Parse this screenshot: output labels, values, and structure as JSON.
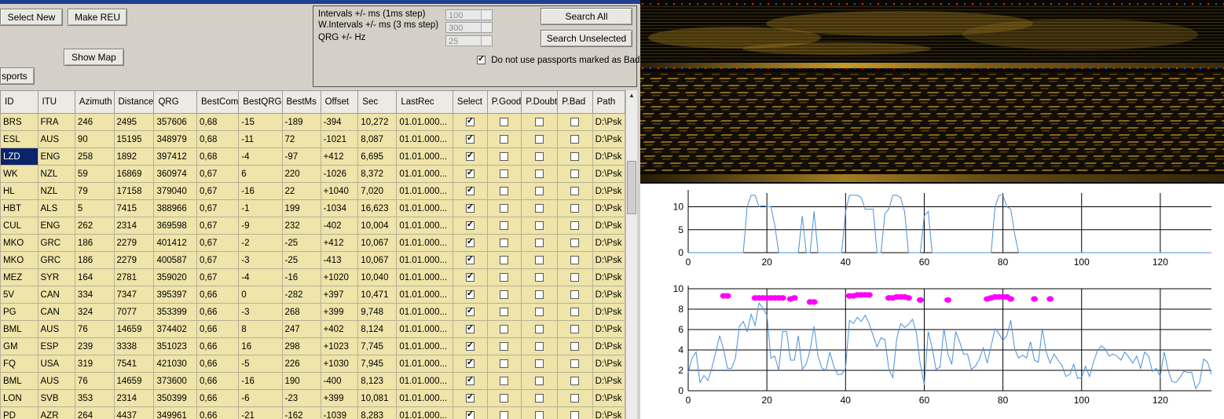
{
  "toolbar": {
    "select_new": "Select New",
    "make_reu": "Make REU",
    "show_map": "Show Map",
    "passports": "sports"
  },
  "search": {
    "intervals_label": "Intervals +/- ms (1ms step)",
    "intervals_value": "100",
    "w_intervals_label": "W.Intervals +/- ms (3 ms step)",
    "w_intervals_value": "300",
    "qrg_label": "QRG +/- Hz",
    "qrg_value": "25",
    "search_all": "Search All",
    "search_unselected": "Search Unselected",
    "do_not_use_bad_label": "Do not use passports marked as Bad",
    "do_not_use_bad_checked": true
  },
  "table": {
    "columns": [
      "ID",
      "ITU",
      "Azimuth",
      "Distance",
      "QRG",
      "BestCom",
      "BestQRG",
      "BestMs",
      "Offset",
      "Sec",
      "LastRec",
      "Select",
      "P.Good",
      "P.Doubt",
      "P.Bad",
      "Path"
    ],
    "selected_row": 2,
    "rows": [
      [
        "BRS",
        "FRA",
        "246",
        "2495",
        "357606",
        "0,68",
        "-15",
        "-189",
        "-394",
        "10,272",
        "01.01.000...",
        true,
        false,
        false,
        false,
        "D:\\Psk"
      ],
      [
        "ESL",
        "AUS",
        "90",
        "15195",
        "348979",
        "0,68",
        "-11",
        "72",
        "-1021",
        "8,087",
        "01.01.000...",
        true,
        false,
        false,
        false,
        "D:\\Psk"
      ],
      [
        "LZD",
        "ENG",
        "258",
        "1892",
        "397412",
        "0,68",
        "-4",
        "-97",
        "+412",
        "6,695",
        "01.01.000...",
        true,
        false,
        false,
        false,
        "D:\\Psk"
      ],
      [
        "WK",
        "NZL",
        "59",
        "16869",
        "360974",
        "0,67",
        "6",
        "220",
        "-1026",
        "8,372",
        "01.01.000...",
        true,
        false,
        false,
        false,
        "D:\\Psk"
      ],
      [
        "HL",
        "NZL",
        "79",
        "17158",
        "379040",
        "0,67",
        "-16",
        "22",
        "+1040",
        "7,020",
        "01.01.000...",
        true,
        false,
        false,
        false,
        "D:\\Psk"
      ],
      [
        "HBT",
        "ALS",
        "5",
        "7415",
        "388966",
        "0,67",
        "-1",
        "199",
        "-1034",
        "16,623",
        "01.01.000...",
        true,
        false,
        false,
        false,
        "D:\\Psk"
      ],
      [
        "CUL",
        "ENG",
        "262",
        "2314",
        "369598",
        "0,67",
        "-9",
        "232",
        "-402",
        "10,004",
        "01.01.000...",
        true,
        false,
        false,
        false,
        "D:\\Psk"
      ],
      [
        "MKO",
        "GRC",
        "186",
        "2279",
        "401412",
        "0,67",
        "-2",
        "-25",
        "+412",
        "10,067",
        "01.01.000...",
        true,
        false,
        false,
        false,
        "D:\\Psk"
      ],
      [
        "MKO",
        "GRC",
        "186",
        "2279",
        "400587",
        "0,67",
        "-3",
        "-25",
        "-413",
        "10,067",
        "01.01.000...",
        true,
        false,
        false,
        false,
        "D:\\Psk"
      ],
      [
        "MEZ",
        "SYR",
        "164",
        "2781",
        "359020",
        "0,67",
        "-4",
        "-16",
        "+1020",
        "10,040",
        "01.01.000...",
        true,
        false,
        false,
        false,
        "D:\\Psk"
      ],
      [
        "5V",
        "CAN",
        "334",
        "7347",
        "395397",
        "0,66",
        "0",
        "-282",
        "+397",
        "10,471",
        "01.01.000...",
        true,
        false,
        false,
        false,
        "D:\\Psk"
      ],
      [
        "PG",
        "CAN",
        "324",
        "7077",
        "353399",
        "0,66",
        "-3",
        "268",
        "+399",
        "9,748",
        "01.01.000...",
        true,
        false,
        false,
        false,
        "D:\\Psk"
      ],
      [
        "BML",
        "AUS",
        "76",
        "14659",
        "374402",
        "0,66",
        "8",
        "247",
        "+402",
        "8,124",
        "01.01.000...",
        true,
        false,
        false,
        false,
        "D:\\Psk"
      ],
      [
        "GM",
        "ESP",
        "239",
        "3338",
        "351023",
        "0,66",
        "16",
        "298",
        "+1023",
        "7,745",
        "01.01.000...",
        true,
        false,
        false,
        false,
        "D:\\Psk"
      ],
      [
        "FQ",
        "USA",
        "319",
        "7541",
        "421030",
        "0,66",
        "-5",
        "226",
        "+1030",
        "7,945",
        "01.01.000...",
        true,
        false,
        false,
        false,
        "D:\\Psk"
      ],
      [
        "BML",
        "AUS",
        "76",
        "14659",
        "373600",
        "0,66",
        "-16",
        "190",
        "-400",
        "8,123",
        "01.01.000...",
        true,
        false,
        false,
        false,
        "D:\\Psk"
      ],
      [
        "LON",
        "SVB",
        "353",
        "2314",
        "350399",
        "0,66",
        "-6",
        "-23",
        "+399",
        "10,081",
        "01.01.000...",
        true,
        false,
        false,
        false,
        "D:\\Psk"
      ],
      [
        "PD",
        "AZR",
        "264",
        "4437",
        "349961",
        "0,66",
        "-21",
        "-162",
        "-1039",
        "8,283",
        "01.01.000...",
        true,
        false,
        false,
        false,
        "D:\\Psk"
      ]
    ]
  },
  "colors": {
    "row_bg": "#efe4a9",
    "selection": "#0a246a",
    "series_line": "#4a90d9",
    "marker": "#ff00ff",
    "waterfall_signal": "#d4a017"
  },
  "chart_data": [
    {
      "type": "line",
      "xlim": [
        0,
        133
      ],
      "ylim": [
        0,
        13
      ],
      "xticks": [
        0,
        20,
        40,
        60,
        80,
        100,
        120
      ],
      "yticks": [
        0,
        5,
        10
      ],
      "grid": true,
      "series": [
        {
          "x": [
            0,
            14,
            15,
            16,
            17,
            18,
            19,
            20,
            21,
            22,
            23,
            28,
            29,
            30,
            31,
            32,
            33,
            39,
            40,
            41,
            42,
            43,
            44,
            45,
            46,
            47,
            48,
            49,
            50,
            51,
            52,
            53,
            54,
            55,
            56,
            57,
            58,
            59,
            60,
            61,
            62,
            63,
            64,
            77,
            78,
            79,
            80,
            81,
            82,
            83,
            84,
            133
          ],
          "y": [
            0,
            0,
            10,
            12.5,
            12.5,
            10,
            10.3,
            10,
            10,
            6,
            0,
            0,
            8,
            0,
            0,
            9,
            0,
            0,
            9,
            12.5,
            12.5,
            12.5,
            12,
            9.5,
            9.5,
            9.5,
            0,
            0,
            8.5,
            9.5,
            12.5,
            12.5,
            12,
            9,
            0,
            0,
            0,
            0,
            8,
            9,
            0,
            0,
            0,
            0,
            10,
            12.5,
            12.5,
            10,
            9.5,
            4,
            0,
            0
          ]
        }
      ]
    },
    {
      "type": "line",
      "xlim": [
        0,
        133
      ],
      "ylim": [
        0,
        10
      ],
      "xticks": [
        0,
        20,
        40,
        60,
        80,
        100,
        120
      ],
      "yticks": [
        0,
        2,
        4,
        6,
        8,
        10
      ],
      "grid": true,
      "series": [
        {
          "type": "line",
          "x": [
            0,
            1,
            2,
            3,
            4,
            5,
            6,
            7,
            8,
            9,
            10,
            11,
            12,
            13,
            14,
            15,
            16,
            17,
            18,
            19,
            20,
            21,
            22,
            23,
            24,
            25,
            26,
            27,
            28,
            29,
            30,
            31,
            32,
            33,
            34,
            35,
            36,
            37,
            38,
            39,
            40,
            41,
            42,
            43,
            44,
            45,
            46,
            47,
            48,
            49,
            50,
            51,
            52,
            53,
            54,
            55,
            56,
            57,
            58,
            59,
            60,
            61,
            62,
            63,
            64,
            65,
            66,
            67,
            68,
            69,
            70,
            71,
            72,
            73,
            74,
            75,
            76,
            77,
            78,
            79,
            80,
            81,
            82,
            83,
            84,
            85,
            86,
            87,
            88,
            89,
            90,
            91,
            92,
            93,
            94,
            95,
            96,
            97,
            98,
            99,
            100,
            101,
            102,
            103,
            104,
            105,
            106,
            107,
            108,
            109,
            110,
            111,
            112,
            113,
            114,
            115,
            116,
            117,
            118,
            119,
            120,
            121,
            122,
            123,
            124,
            125,
            126,
            127,
            128,
            129,
            130,
            131,
            132,
            133
          ],
          "y": [
            1.8,
            3.2,
            3.8,
            0.8,
            1.5,
            1,
            2.2,
            3.8,
            5.4,
            4,
            2.2,
            2.2,
            3.2,
            6.3,
            6.8,
            5.8,
            7.5,
            6.4,
            8.6,
            8.1,
            7.4,
            3.2,
            3.4,
            2,
            5.8,
            5.8,
            3,
            3,
            5.4,
            2.1,
            2.6,
            4,
            6.3,
            3.4,
            2.2,
            2,
            3.8,
            2.4,
            1.6,
            1.6,
            2.2,
            6.9,
            6.6,
            7.2,
            6.8,
            7.4,
            6.6,
            5.4,
            4.3,
            5.2,
            5,
            2.1,
            1.3,
            5.1,
            6.6,
            6.2,
            6.5,
            7,
            5.7,
            2.6,
            0.6,
            5.8,
            4.2,
            2.1,
            2.3,
            6.1,
            3.6,
            2.6,
            5.8,
            4.8,
            3.6,
            3.6,
            2.1,
            2.4,
            3.1,
            4.2,
            2.7,
            4.4,
            6.1,
            5.6,
            4.9,
            5.4,
            6.9,
            4.1,
            3.2,
            3.5,
            3.2,
            4.8,
            3,
            2.8,
            6.1,
            3.8,
            2.7,
            3.6,
            3,
            2.5,
            1.4,
            1.6,
            2.6,
            1.2,
            1.3,
            2.4,
            1.4,
            2.8,
            3.9,
            4.4,
            4.1,
            3.4,
            3.6,
            3.4,
            3,
            3.8,
            3.3,
            2.7,
            3.4,
            2.2,
            3.8,
            3.4,
            1.9,
            2.2,
            1.4,
            3.8,
            2,
            0.9,
            0.8,
            1.3,
            1.9,
            1.8,
            1.8,
            0.2,
            0.8,
            3.1,
            2.8,
            1.6
          ]
        },
        {
          "type": "scatter",
          "x": [
            9,
            10,
            17,
            18,
            19,
            20,
            21,
            22,
            23,
            24,
            26,
            27,
            31,
            32,
            41,
            42,
            43,
            44,
            45,
            46,
            51,
            52,
            53,
            54,
            55,
            56,
            59,
            66,
            76,
            77,
            78,
            79,
            80,
            81,
            82,
            88,
            92
          ],
          "y": [
            9.3,
            9.3,
            9.1,
            9.1,
            9.1,
            9.1,
            9.1,
            9.1,
            9.1,
            9.1,
            9,
            9.1,
            8.7,
            8.7,
            9.3,
            9.3,
            9.4,
            9.4,
            9.4,
            9.4,
            9.1,
            9.1,
            9.2,
            9.2,
            9.2,
            9.1,
            8.9,
            8.9,
            9,
            9.1,
            9.2,
            9.2,
            9.2,
            9.2,
            9,
            9,
            9
          ]
        }
      ]
    }
  ]
}
